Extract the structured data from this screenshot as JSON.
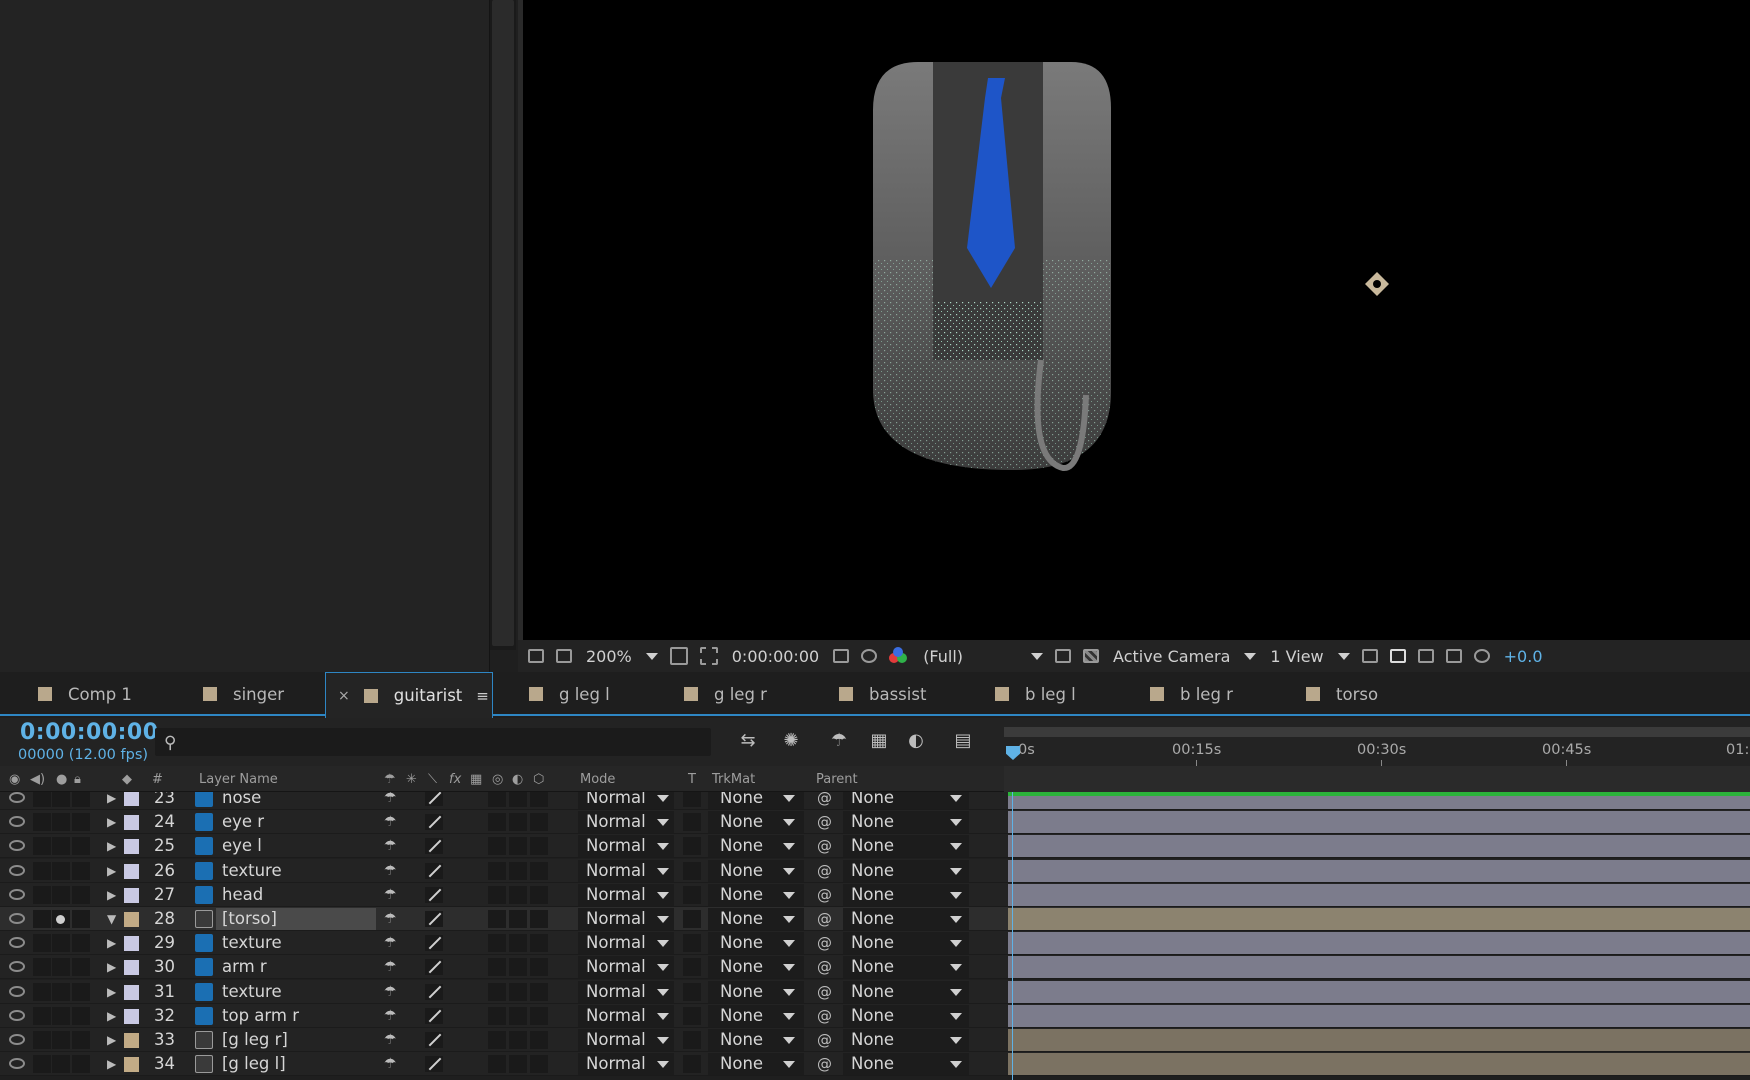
{
  "viewer_toolbar": {
    "zoom": "200%",
    "timecode": "0:00:00:00",
    "resolution": "(Full)",
    "camera": "Active Camera",
    "views": "1 View",
    "exposure": "+0.0"
  },
  "tabs": [
    {
      "label": "Comp 1",
      "active": false
    },
    {
      "label": "singer",
      "active": false
    },
    {
      "label": "guitarist",
      "active": true
    },
    {
      "label": "g leg l",
      "active": false
    },
    {
      "label": "g leg r",
      "active": false
    },
    {
      "label": "bassist",
      "active": false
    },
    {
      "label": "b leg l",
      "active": false
    },
    {
      "label": "b leg r",
      "active": false
    },
    {
      "label": "torso",
      "active": false
    }
  ],
  "tab_close": "×",
  "tab_menu": "≡",
  "timeline": {
    "timecode": "0:00:00:00",
    "frame_info": "00000 (12.00 fps)",
    "ruler_labels": [
      "0s",
      "00:15s",
      "00:30s",
      "00:45s",
      "01:"
    ]
  },
  "columns": {
    "hash": "#",
    "layer_name": "Layer Name",
    "fx": "fx",
    "mode": "Mode",
    "t": "T",
    "trkmat": "TrkMat",
    "parent": "Parent"
  },
  "layers": [
    {
      "num": "23",
      "name": "nose",
      "type": "ps",
      "label_color": "#c9c9e3",
      "mode": "Normal",
      "trkmat": "None",
      "parent": "None",
      "bar": "lav"
    },
    {
      "num": "24",
      "name": "eye r",
      "type": "ps",
      "label_color": "#c9c9e3",
      "mode": "Normal",
      "trkmat": "None",
      "parent": "None",
      "bar": "lav"
    },
    {
      "num": "25",
      "name": "eye l",
      "type": "ps",
      "label_color": "#c9c9e3",
      "mode": "Normal",
      "trkmat": "None",
      "parent": "None",
      "bar": "lav"
    },
    {
      "num": "26",
      "name": "texture",
      "type": "ps",
      "label_color": "#c9c9e3",
      "mode": "Normal",
      "trkmat": "None",
      "parent": "None",
      "bar": "lav"
    },
    {
      "num": "27",
      "name": "head",
      "type": "ps",
      "label_color": "#c9c9e3",
      "mode": "Normal",
      "trkmat": "None",
      "parent": "None",
      "bar": "lav"
    },
    {
      "num": "28",
      "name": "[torso]",
      "type": "comp",
      "label_color": "#c2ab86",
      "mode": "Normal",
      "trkmat": "None",
      "parent": "None",
      "bar": "tan",
      "selected": true
    },
    {
      "num": "29",
      "name": "texture",
      "type": "ps",
      "label_color": "#c9c9e3",
      "mode": "Normal",
      "trkmat": "None",
      "parent": "None",
      "bar": "lav"
    },
    {
      "num": "30",
      "name": "arm r",
      "type": "ps",
      "label_color": "#c9c9e3",
      "mode": "Normal",
      "trkmat": "None",
      "parent": "None",
      "bar": "lav"
    },
    {
      "num": "31",
      "name": "texture",
      "type": "ps",
      "label_color": "#c9c9e3",
      "mode": "Normal",
      "trkmat": "None",
      "parent": "None",
      "bar": "lav"
    },
    {
      "num": "32",
      "name": "top arm r",
      "type": "ps",
      "label_color": "#c9c9e3",
      "mode": "Normal",
      "trkmat": "None",
      "parent": "None",
      "bar": "lav"
    },
    {
      "num": "33",
      "name": "[g leg r]",
      "type": "comp",
      "label_color": "#c2ab86",
      "mode": "Normal",
      "trkmat": "None",
      "parent": "None",
      "bar": "tan"
    },
    {
      "num": "34",
      "name": "[g leg l]",
      "type": "comp",
      "label_color": "#c2ab86",
      "mode": "Normal",
      "trkmat": "None",
      "parent": "None",
      "bar": "tan"
    }
  ]
}
